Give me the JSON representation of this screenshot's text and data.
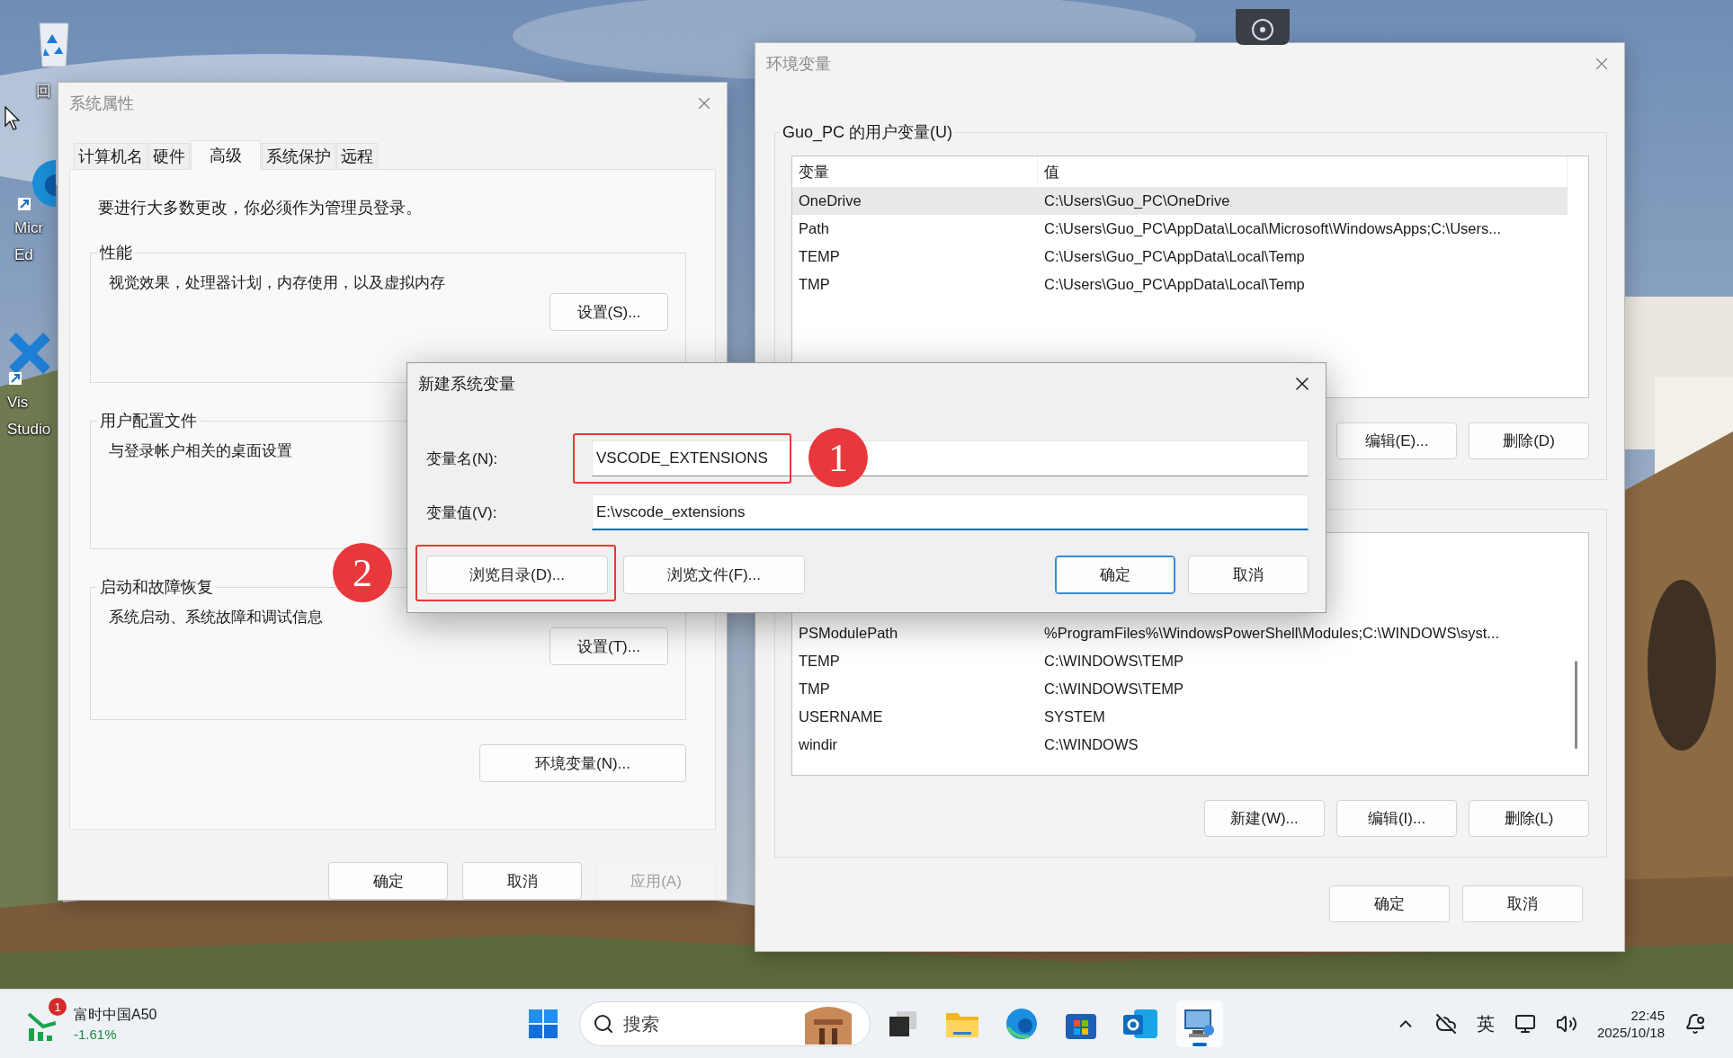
{
  "desktop": {
    "icons": [
      {
        "kind": "recycle_bin",
        "lines": [
          "回"
        ]
      },
      {
        "kind": "browser",
        "lines": [
          "Micr",
          "Ed"
        ]
      },
      {
        "kind": "ide",
        "lines": [
          "Vis",
          "Studio"
        ]
      }
    ]
  },
  "system_properties": {
    "title": "系统属性",
    "tabs": [
      {
        "label": "计算机名",
        "selected": false
      },
      {
        "label": "硬件",
        "selected": false
      },
      {
        "label": "高级",
        "selected": true
      },
      {
        "label": "系统保护",
        "selected": false
      },
      {
        "label": "远程",
        "selected": false
      }
    ],
    "notice": "要进行大多数更改，你必须作为管理员登录。",
    "groups": [
      {
        "title": "性能",
        "description": "视觉效果，处理器计划，内存使用，以及虚拟内存",
        "button": "设置(S)..."
      },
      {
        "title": "用户配置文件",
        "description": "与登录帐户相关的桌面设置"
      },
      {
        "title": "启动和故障恢复",
        "description": "系统启动、系统故障和调试信息",
        "button": "设置(T)..."
      }
    ],
    "env_button": "环境变量(N)...",
    "buttons": [
      {
        "label": "确定",
        "disabled": false
      },
      {
        "label": "取消",
        "disabled": false
      },
      {
        "label": "应用(A)",
        "disabled": true
      }
    ]
  },
  "environment_variables": {
    "title": "环境变量",
    "user_group": "Guo_PC 的用户变量(U)",
    "columns": [
      "变量",
      "值"
    ],
    "user_rows": [
      {
        "name": "OneDrive",
        "value": "C:\\Users\\Guo_PC\\OneDrive",
        "selected": true
      },
      {
        "name": "Path",
        "value": "C:\\Users\\Guo_PC\\AppData\\Local\\Microsoft\\WindowsApps;C:\\Users...",
        "selected": false
      },
      {
        "name": "TEMP",
        "value": "C:\\Users\\Guo_PC\\AppData\\Local\\Temp",
        "selected": false
      },
      {
        "name": "TMP",
        "value": "C:\\Users\\Guo_PC\\AppData\\Local\\Temp",
        "selected": false
      }
    ],
    "user_buttons": [
      "编辑(E)...",
      "删除(D)"
    ],
    "system_rows": [
      {
        "name": "PSModulePath",
        "value": "%ProgramFiles%\\WindowsPowerShell\\Modules;C:\\WINDOWS\\syst..."
      },
      {
        "name": "TEMP",
        "value": "C:\\WINDOWS\\TEMP"
      },
      {
        "name": "TMP",
        "value": "C:\\WINDOWS\\TEMP"
      },
      {
        "name": "USERNAME",
        "value": "SYSTEM"
      },
      {
        "name": "windir",
        "value": "C:\\WINDOWS"
      }
    ],
    "system_buttons": [
      "新建(W)...",
      "编辑(I)...",
      "删除(L)"
    ],
    "buttons": [
      "确定",
      "取消"
    ]
  },
  "new_variable_dialog": {
    "title": "新建系统变量",
    "fields": [
      {
        "label": "变量名(N):",
        "value": "VSCODE_EXTENSIONS",
        "focused": false
      },
      {
        "label": "变量值(V):",
        "value": "E:\\vscode_extensions",
        "focused": true
      }
    ],
    "buttons": [
      {
        "label": "浏览目录(D)...",
        "default": false
      },
      {
        "label": "浏览文件(F)...",
        "default": false
      },
      {
        "label": "确定",
        "default": true
      },
      {
        "label": "取消",
        "default": false
      }
    ]
  },
  "annotations": [
    {
      "number": "1"
    },
    {
      "number": "2"
    }
  ],
  "taskbar": {
    "widget": {
      "badge": "1",
      "name": "富时中国A50",
      "change": "-1.61%"
    },
    "search": {
      "placeholder": "搜索"
    },
    "apps": [
      {
        "kind": "task_view",
        "active": false
      },
      {
        "kind": "folder",
        "active": false
      },
      {
        "kind": "browser",
        "active": false
      },
      {
        "kind": "store",
        "active": false
      },
      {
        "kind": "mail",
        "active": false
      },
      {
        "kind": "system_app",
        "active": true
      }
    ],
    "input_method": "英",
    "time": "22:45",
    "date": "2025/10/18"
  }
}
